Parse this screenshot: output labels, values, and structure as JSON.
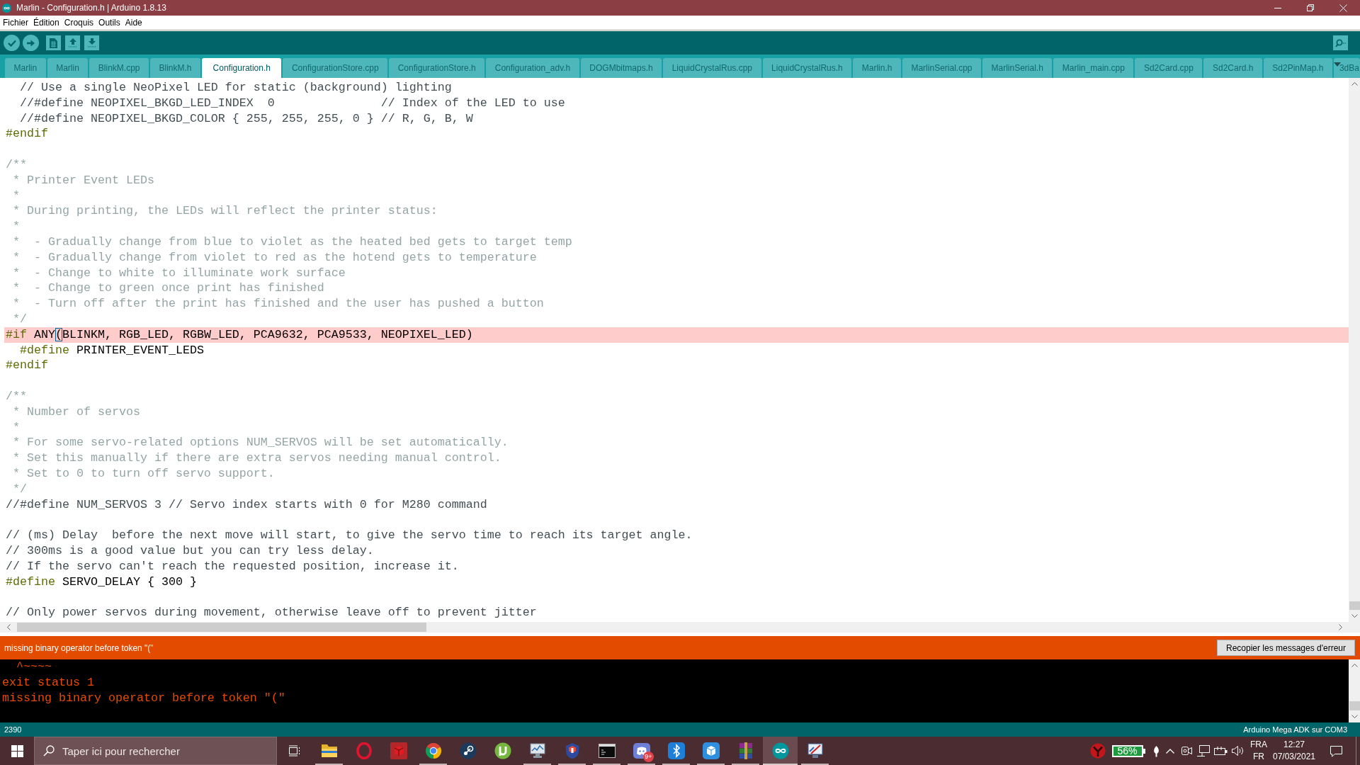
{
  "window": {
    "title": "Marlin - Configuration.h | Arduino 1.8.13"
  },
  "menu": [
    "Fichier",
    "Édition",
    "Croquis",
    "Outils",
    "Aide"
  ],
  "tabs": [
    {
      "label": "Marlin",
      "selected": false
    },
    {
      "label": "Marlin",
      "selected": false
    },
    {
      "label": "BlinkM.cpp",
      "selected": false
    },
    {
      "label": "BlinkM.h",
      "selected": false
    },
    {
      "label": "Configuration.h",
      "selected": true
    },
    {
      "label": "ConfigurationStore.cpp",
      "selected": false
    },
    {
      "label": "ConfigurationStore.h",
      "selected": false
    },
    {
      "label": "Configuration_adv.h",
      "selected": false
    },
    {
      "label": "DOGMbitmaps.h",
      "selected": false
    },
    {
      "label": "LiquidCrystalRus.cpp",
      "selected": false
    },
    {
      "label": "LiquidCrystalRus.h",
      "selected": false
    },
    {
      "label": "Marlin.h",
      "selected": false
    },
    {
      "label": "MarlinSerial.cpp",
      "selected": false
    },
    {
      "label": "MarlinSerial.h",
      "selected": false
    },
    {
      "label": "Marlin_main.cpp",
      "selected": false
    },
    {
      "label": "Sd2Card.cpp",
      "selected": false
    },
    {
      "label": "Sd2Card.h",
      "selected": false
    },
    {
      "label": "Sd2PinMap.h",
      "selected": false
    },
    {
      "label": "3dBa",
      "selected": false
    }
  ],
  "editor": {
    "lines": [
      {
        "highlighted": false,
        "segments": [
          {
            "kind": "line_comment",
            "text": "  // Use a single NeoPixel LED for static (background) lighting"
          }
        ]
      },
      {
        "highlighted": false,
        "segments": [
          {
            "kind": "line_comment",
            "text": "  //#define NEOPIXEL_BKGD_LED_INDEX  0               // Index of the LED to use"
          }
        ]
      },
      {
        "highlighted": false,
        "segments": [
          {
            "kind": "line_comment",
            "text": "  //#define NEOPIXEL_BKGD_COLOR { 255, 255, 255, 0 } // R, G, B, W"
          }
        ]
      },
      {
        "highlighted": false,
        "segments": [
          {
            "kind": "directive",
            "text": "#endif"
          }
        ]
      },
      {
        "highlighted": false
      },
      {
        "highlighted": false,
        "segments": [
          {
            "kind": "block_comment",
            "text": "/**"
          }
        ]
      },
      {
        "highlighted": false,
        "segments": [
          {
            "kind": "block_comment",
            "text": " * Printer Event LEDs"
          }
        ]
      },
      {
        "highlighted": false,
        "segments": [
          {
            "kind": "block_comment",
            "text": " *"
          }
        ]
      },
      {
        "highlighted": false,
        "segments": [
          {
            "kind": "block_comment",
            "text": " * During printing, the LEDs will reflect the printer status:"
          }
        ]
      },
      {
        "highlighted": false,
        "segments": [
          {
            "kind": "block_comment",
            "text": " *"
          }
        ]
      },
      {
        "highlighted": false,
        "segments": [
          {
            "kind": "block_comment",
            "text": " *  - Gradually change from blue to violet as the heated bed gets to target temp"
          }
        ]
      },
      {
        "highlighted": false,
        "segments": [
          {
            "kind": "block_comment",
            "text": " *  - Gradually change from violet to red as the hotend gets to temperature"
          }
        ]
      },
      {
        "highlighted": false,
        "segments": [
          {
            "kind": "block_comment",
            "text": " *  - Change to white to illuminate work surface"
          }
        ]
      },
      {
        "highlighted": false,
        "segments": [
          {
            "kind": "block_comment",
            "text": " *  - Change to green once print has finished"
          }
        ]
      },
      {
        "highlighted": false,
        "segments": [
          {
            "kind": "block_comment",
            "text": " *  - Turn off after the print has finished and the user has pushed a button"
          }
        ]
      },
      {
        "highlighted": false,
        "segments": [
          {
            "kind": "block_comment",
            "text": " */"
          }
        ]
      },
      {
        "highlighted": true,
        "segments": [
          {
            "kind": "directive",
            "text": "#if"
          },
          {
            "kind": "plain",
            "text": " ANY"
          },
          {
            "kind": "matched_bracket",
            "text": "("
          },
          {
            "kind": "plain",
            "text": "BLINKM, RGB_LED, RGBW_LED, PCA9632, PCA9533, NEOPIXEL_LED)"
          }
        ]
      },
      {
        "highlighted": false,
        "segments": [
          {
            "kind": "directive",
            "text": "  #define"
          },
          {
            "kind": "plain",
            "text": " PRINTER_EVENT_LEDS"
          }
        ]
      },
      {
        "highlighted": false,
        "segments": [
          {
            "kind": "directive",
            "text": "#endif"
          }
        ]
      },
      {
        "highlighted": false
      },
      {
        "highlighted": false,
        "segments": [
          {
            "kind": "block_comment",
            "text": "/**"
          }
        ]
      },
      {
        "highlighted": false,
        "segments": [
          {
            "kind": "block_comment",
            "text": " * Number of servos"
          }
        ]
      },
      {
        "highlighted": false,
        "segments": [
          {
            "kind": "block_comment",
            "text": " *"
          }
        ]
      },
      {
        "highlighted": false,
        "segments": [
          {
            "kind": "block_comment",
            "text": " * For some servo-related options NUM_SERVOS will be set automatically."
          }
        ]
      },
      {
        "highlighted": false,
        "segments": [
          {
            "kind": "block_comment",
            "text": " * Set this manually if there are extra servos needing manual control."
          }
        ]
      },
      {
        "highlighted": false,
        "segments": [
          {
            "kind": "block_comment",
            "text": " * Set to 0 to turn off servo support."
          }
        ]
      },
      {
        "highlighted": false,
        "segments": [
          {
            "kind": "block_comment",
            "text": " */"
          }
        ]
      },
      {
        "highlighted": false,
        "segments": [
          {
            "kind": "line_comment",
            "text": "//#define NUM_SERVOS 3 // Servo index starts with 0 for M280 command"
          }
        ]
      },
      {
        "highlighted": false
      },
      {
        "highlighted": false,
        "segments": [
          {
            "kind": "line_comment",
            "text": "// (ms) Delay  before the next move will start, to give the servo time to reach its target angle."
          }
        ]
      },
      {
        "highlighted": false,
        "segments": [
          {
            "kind": "line_comment",
            "text": "// 300ms is a good value but you can try less delay."
          }
        ]
      },
      {
        "highlighted": false,
        "segments": [
          {
            "kind": "line_comment",
            "text": "// If the servo can't reach the requested position, increase it."
          }
        ]
      },
      {
        "highlighted": false,
        "segments": [
          {
            "kind": "directive",
            "text": "#define"
          },
          {
            "kind": "plain",
            "text": " SERVO_DELAY { 300 }"
          }
        ]
      },
      {
        "highlighted": false
      },
      {
        "highlighted": false,
        "segments": [
          {
            "kind": "line_comment",
            "text": "// Only power servos during movement, otherwise leave off to prevent jitter"
          }
        ]
      }
    ]
  },
  "error_bar": {
    "message": "missing binary operator before token \"(\"",
    "button": "Recopier les messages d'erreur"
  },
  "console": {
    "lines": [
      "  ^~~~~",
      "exit status 1",
      "missing binary operator before token \"(\""
    ]
  },
  "status_bar": {
    "line": "2390",
    "board": "Arduino Mega ADK sur COM3"
  },
  "taskbar": {
    "search": {
      "placeholder": "Taper ici pour rechercher"
    },
    "apps": [
      {
        "running": true,
        "selected": false
      },
      {
        "running": false,
        "selected": false
      },
      {
        "running": false,
        "selected": false
      },
      {
        "running": true,
        "selected": false
      },
      {
        "running": false,
        "selected": false
      },
      {
        "running": false,
        "selected": false
      },
      {
        "running": true,
        "selected": false
      },
      {
        "running": true,
        "selected": false
      },
      {
        "running": true,
        "selected": false
      },
      {
        "running": true,
        "selected": false,
        "badge": "9+"
      },
      {
        "running": true,
        "selected": false
      },
      {
        "running": true,
        "selected": false
      },
      {
        "running": true,
        "selected": false
      },
      {
        "running": true,
        "selected": true
      },
      {
        "running": true,
        "selected": false
      }
    ],
    "battery": "56%",
    "language": {
      "input": "FRA",
      "layout": "FR"
    },
    "clock": {
      "time": "12:27",
      "date": "07/03/2021"
    }
  }
}
